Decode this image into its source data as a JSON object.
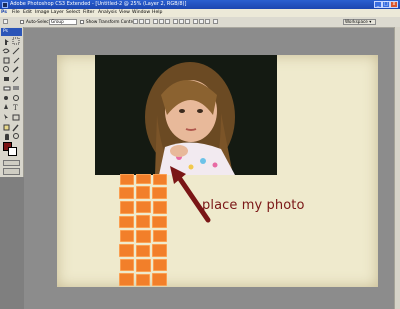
{
  "window": {
    "title": "Adobe Photoshop CS3 Extended - [Untitled-2 @ 25% (Layer 2, RGB/8)]",
    "app_icon": "photoshop-icon",
    "controls": [
      "minimize-icon",
      "maximize-icon",
      "close-icon"
    ]
  },
  "menubar": {
    "items": [
      "File",
      "Edit",
      "Image",
      "Layer",
      "Select",
      "Filter",
      "Analysis",
      "View",
      "Window",
      "Help"
    ]
  },
  "options_bar": {
    "auto_select_label": "Auto-Select:",
    "auto_select_value": "Group",
    "show_transform_label": "Show Transform Controls",
    "workspace_label": "Workspace ▾"
  },
  "toolbox": {
    "header": "Ps",
    "foreground_color": "#7a1414",
    "background_color": "#ffffff"
  },
  "canvas": {
    "paper_color": "#efeacd",
    "tile_color": "#f27f2a",
    "arrow_color": "#7a1616",
    "annotation": "place my photo"
  }
}
